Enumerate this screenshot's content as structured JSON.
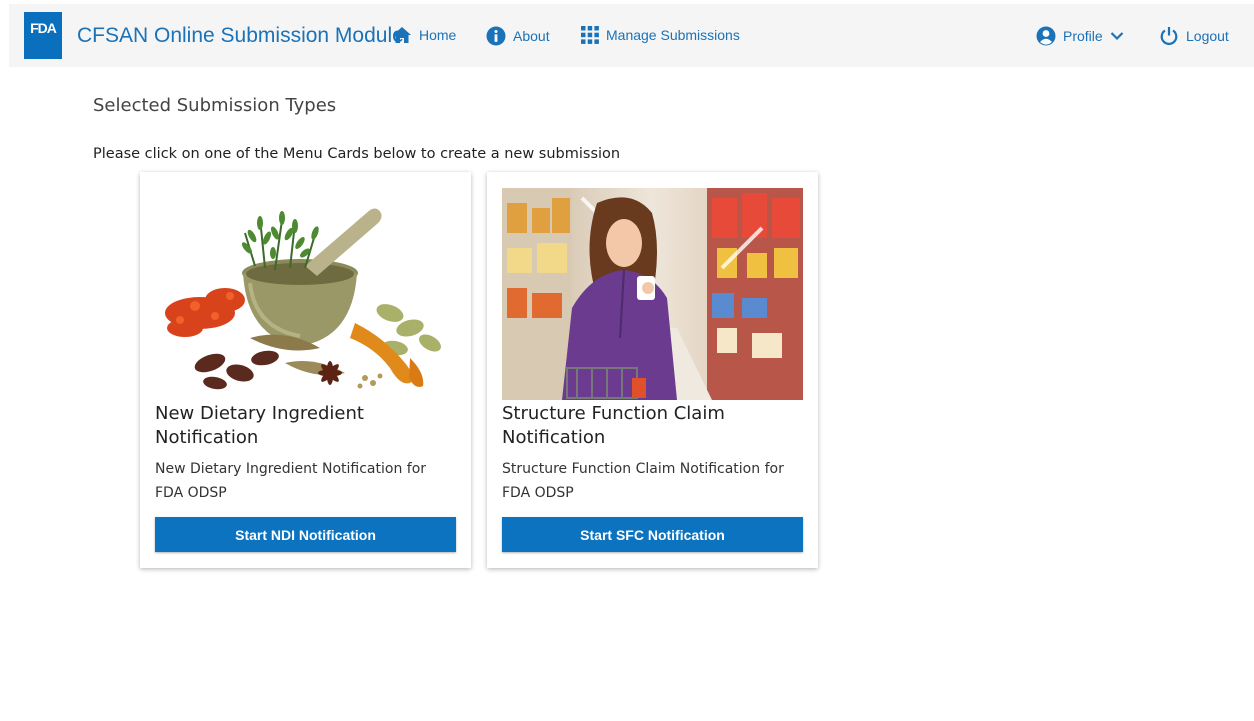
{
  "header": {
    "logo_text": "FDA",
    "app_title": "CFSAN Online Submission Module",
    "nav": {
      "home": "Home",
      "about": "About",
      "manage": "Manage Submissions",
      "profile": "Profile",
      "logout": "Logout"
    },
    "icons": [
      "home-icon",
      "info-icon",
      "grid-icon",
      "user-circle-icon",
      "chevron-down-icon",
      "power-icon"
    ],
    "colors": {
      "nav_text": "#1a72b8",
      "logo_bg": "#0a6fbd",
      "navbar_bg": "#f5f5f5"
    }
  },
  "main": {
    "section_title": "Selected Submission Types",
    "instructions": "Please click on one of the Menu Cards below to create a new submission",
    "cards": [
      {
        "title": "New Dietary Ingredient Notification",
        "description": "New Dietary Ingredient Notification for FDA ODSP",
        "button": "Start NDI Notification"
      },
      {
        "title": "Structure Function Claim Notification",
        "description": "Structure Function Claim Notification for FDA ODSP",
        "button": "Start SFC Notification"
      }
    ],
    "colors": {
      "button_bg": "#0b73c0"
    }
  }
}
